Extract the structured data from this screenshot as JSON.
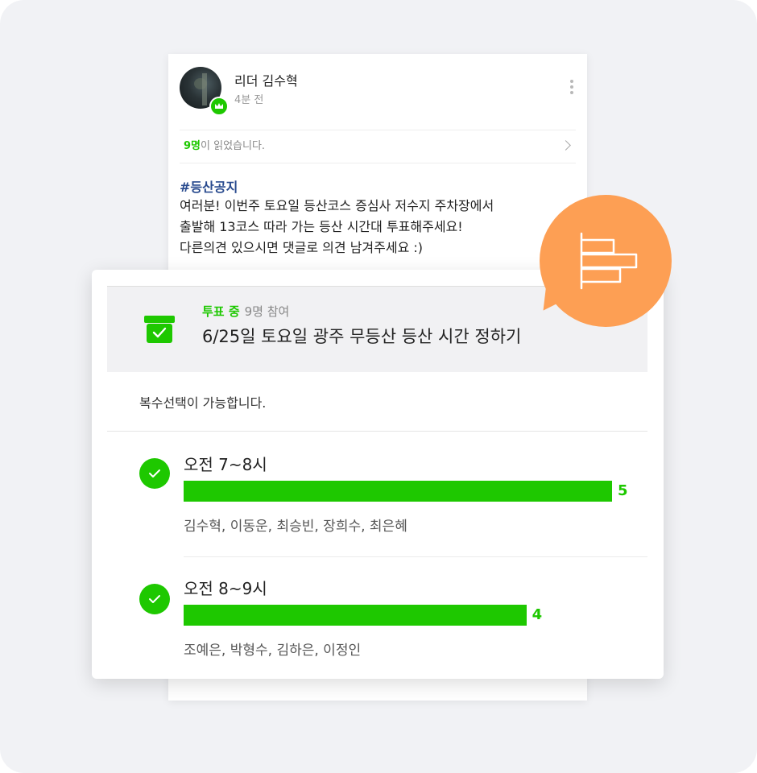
{
  "post": {
    "author": "리더 김수혁",
    "time": "4분 전",
    "read_count": "9명",
    "read_suffix": "이 읽었습니다.",
    "hashtag": "#등산공지",
    "body_lines": [
      "여러분! 이번주 토요일 등산코스 증심사 저수지 주차장에서",
      "출발해 13코스 따라 가는 등산 시간대 투표해주세요!",
      "다른의견 있으시면 댓글로 의견 남겨주세요 :)"
    ]
  },
  "vote": {
    "status": "투표 중",
    "participants": "9명 참여",
    "title": "6/25일 토요일 광주 무등산 등산 시간 정하기",
    "multi_note": "복수선택이 가능합니다.",
    "max_votes": 9,
    "options": [
      {
        "label": "오전 7~8시",
        "count": 5,
        "voters": "김수혁, 이동운, 최승빈, 장희수, 최은혜"
      },
      {
        "label": "오전 8~9시",
        "count": 4,
        "voters": "조예은, 박형수, 김하은, 이정인"
      }
    ]
  },
  "icons": {
    "avatar_badge": "crown-icon",
    "more": "more-vertical-icon",
    "read_arrow": "chevron-right-icon",
    "vote_box": "ballot-box-icon",
    "option_check": "check-circle-icon",
    "bubble": "bar-chart-icon"
  },
  "colors": {
    "accent_green": "#1ec800",
    "hashtag_blue": "#284a8e",
    "bubble_orange": "#fd9f54"
  }
}
